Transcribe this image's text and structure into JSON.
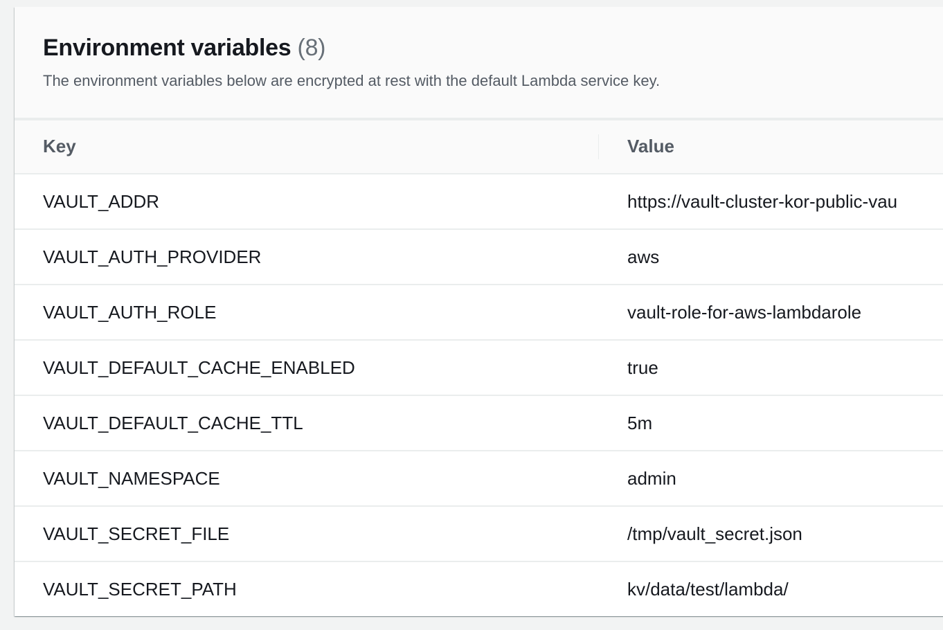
{
  "panel": {
    "title": "Environment variables",
    "count": "(8)",
    "description": "The environment variables below are encrypted at rest with the default Lambda service key."
  },
  "table": {
    "columns": [
      "Key",
      "Value"
    ],
    "rows": [
      {
        "key": "VAULT_ADDR",
        "value": "https://vault-cluster-kor-public-vau"
      },
      {
        "key": "VAULT_AUTH_PROVIDER",
        "value": "aws"
      },
      {
        "key": "VAULT_AUTH_ROLE",
        "value": "vault-role-for-aws-lambdarole"
      },
      {
        "key": "VAULT_DEFAULT_CACHE_ENABLED",
        "value": "true"
      },
      {
        "key": "VAULT_DEFAULT_CACHE_TTL",
        "value": "5m"
      },
      {
        "key": "VAULT_NAMESPACE",
        "value": "admin"
      },
      {
        "key": "VAULT_SECRET_FILE",
        "value": "/tmp/vault_secret.json"
      },
      {
        "key": "VAULT_SECRET_PATH",
        "value": "kv/data/test/lambda/"
      }
    ]
  }
}
